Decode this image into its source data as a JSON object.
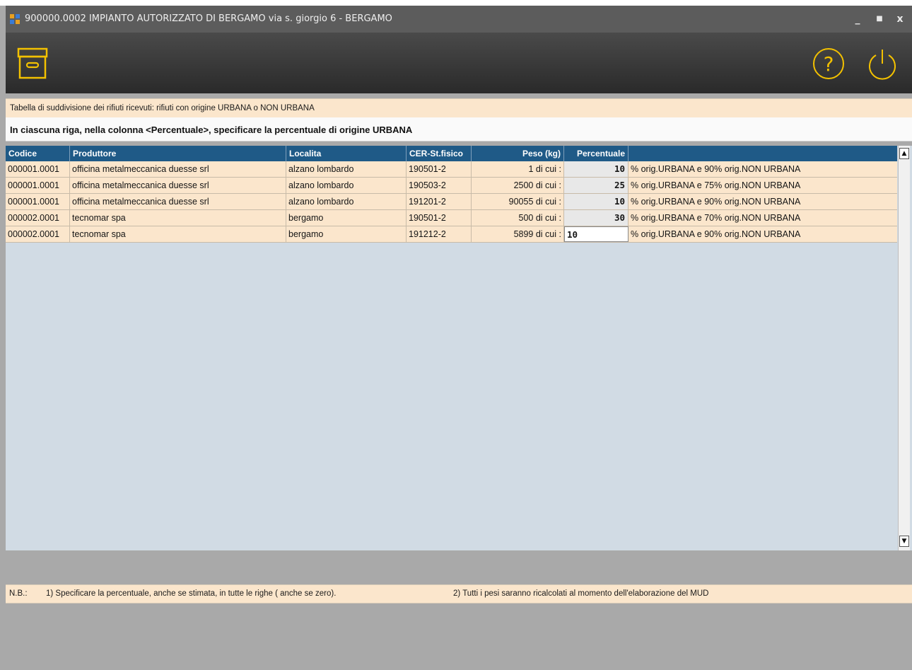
{
  "window": {
    "title": "900000.0002  IMPIANTO AUTORIZZATO DI BERGAMO via s. giorgio 6 - BERGAMO",
    "controls": {
      "minimize": "_",
      "maximize": "■",
      "close": "x"
    }
  },
  "toolbar": {
    "archive_icon": "archive-box-icon",
    "help_icon": "help-icon",
    "power_icon": "power-icon",
    "accent": "#f3c100"
  },
  "info": {
    "subtitle": "Tabella di suddivisione  dei rifiuti ricevuti:  rifiuti con origine URBANA o NON URBANA",
    "instruction": "In ciascuna riga, nella colonna <Percentuale>, specificare la percentuale di origine URBANA"
  },
  "table": {
    "headers": {
      "codice": "Codice",
      "produttore": "Produttore",
      "localita": "Localita",
      "cer": "CER-St.fisico",
      "peso": "Peso (kg)",
      "percentuale": "Percentuale",
      "note": ""
    },
    "rows": [
      {
        "codice": "000001.0001",
        "produttore": "officina metalmeccanica duesse srl",
        "localita": "alzano lombardo",
        "cer": "190501-2",
        "peso": "1  di cui :",
        "percentuale": "10",
        "note": "% orig.URBANA  e  90% orig.NON URBANA"
      },
      {
        "codice": "000001.0001",
        "produttore": "officina metalmeccanica duesse srl",
        "localita": "alzano lombardo",
        "cer": "190503-2",
        "peso": "2500  di cui :",
        "percentuale": "25",
        "note": "% orig.URBANA  e  75% orig.NON URBANA"
      },
      {
        "codice": "000001.0001",
        "produttore": "officina metalmeccanica duesse srl",
        "localita": "alzano lombardo",
        "cer": "191201-2",
        "peso": "90055  di cui :",
        "percentuale": "10",
        "note": "% orig.URBANA  e  90% orig.NON URBANA"
      },
      {
        "codice": "000002.0001",
        "produttore": "tecnomar spa",
        "localita": "bergamo",
        "cer": "190501-2",
        "peso": "500  di cui :",
        "percentuale": "30",
        "note": "% orig.URBANA  e  70% orig.NON URBANA"
      },
      {
        "codice": "000002.0001",
        "produttore": "tecnomar spa",
        "localita": "bergamo",
        "cer": "191212-2",
        "peso": "5899  di cui :",
        "percentuale": "10",
        "note": "% orig.URBANA  e  90% orig.NON URBANA"
      }
    ]
  },
  "footer": {
    "nb": "N.B.:",
    "note1": "1) Specificare la percentuale, anche se stimata, in tutte le righe ( anche se zero).",
    "note2": "2) Tutti i pesi   saranno ricalcolati al momento dell'elaborazione del MUD"
  },
  "colors": {
    "header_bg": "#1f5a87",
    "row_bg": "#fbe6cc",
    "grid_bg": "#d1dbe4",
    "window_bg": "#a9a9a9"
  }
}
